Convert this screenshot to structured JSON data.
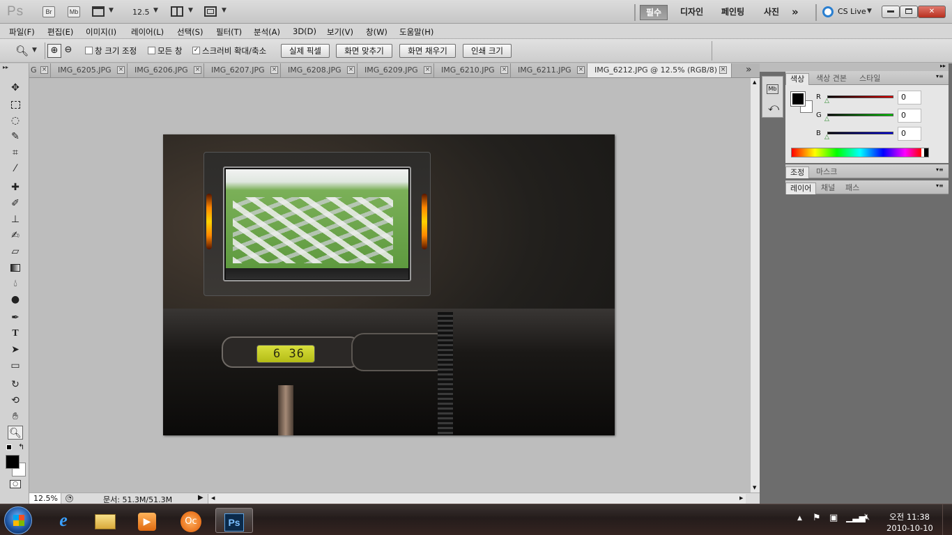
{
  "app": {
    "logo": "Ps"
  },
  "appbar": {
    "bridge": "Br",
    "minibridge": "Mb",
    "zoom": "12.5",
    "workspaces": [
      "필수",
      "디자인",
      "페인팅",
      "사진"
    ],
    "more": "»",
    "cslive": "CS Live"
  },
  "menu": [
    "파일(F)",
    "편집(E)",
    "이미지(I)",
    "레이어(L)",
    "선택(S)",
    "필터(T)",
    "분석(A)",
    "3D(D)",
    "보기(V)",
    "창(W)",
    "도움말(H)"
  ],
  "options": {
    "resize_windows": {
      "label": "창 크기 조정",
      "checked": false
    },
    "all_windows": {
      "label": "모든 창",
      "checked": false
    },
    "scrubby_zoom": {
      "label": "스크러비 확대/축소",
      "checked": true
    },
    "buttons": [
      "실제 픽셀",
      "화면 맞추기",
      "화면 채우기",
      "인쇄 크기"
    ]
  },
  "tabs": [
    {
      "label": "G",
      "active": false
    },
    {
      "label": "IMG_6205.JPG",
      "active": false
    },
    {
      "label": "IMG_6206.JPG",
      "active": false
    },
    {
      "label": "IMG_6207.JPG",
      "active": false
    },
    {
      "label": "IMG_6208.JPG",
      "active": false
    },
    {
      "label": "IMG_6209.JPG",
      "active": false
    },
    {
      "label": "IMG_6210.JPG",
      "active": false
    },
    {
      "label": "IMG_6211.JPG",
      "active": false
    },
    {
      "label": "IMG_6212.JPG @ 12.5% (RGB/8)",
      "active": true
    }
  ],
  "tab_overflow": "»",
  "status": {
    "zoom": "12.5%",
    "doc": "문서: 51.3M/51.3M"
  },
  "photo": {
    "clock": "6 36"
  },
  "color_panel": {
    "tabs": [
      "색상",
      "색상 견본",
      "스타일"
    ],
    "channels": [
      {
        "label": "R",
        "value": "0",
        "color": "#d40000"
      },
      {
        "label": "G",
        "value": "0",
        "color": "#00c000"
      },
      {
        "label": "B",
        "value": "0",
        "color": "#0000d0"
      }
    ]
  },
  "adjust_panel": {
    "tabs": [
      "조정",
      "마스크"
    ]
  },
  "layers_panel": {
    "tabs": [
      "레이어",
      "채널",
      "패스"
    ]
  },
  "taskbar": {
    "time": "오전 11:38",
    "date": "2010-10-10",
    "apps": [
      "start-orb",
      "internet-explorer",
      "file-explorer",
      "media-player",
      "oc-app",
      "photoshop"
    ],
    "ps_label": "Ps"
  }
}
